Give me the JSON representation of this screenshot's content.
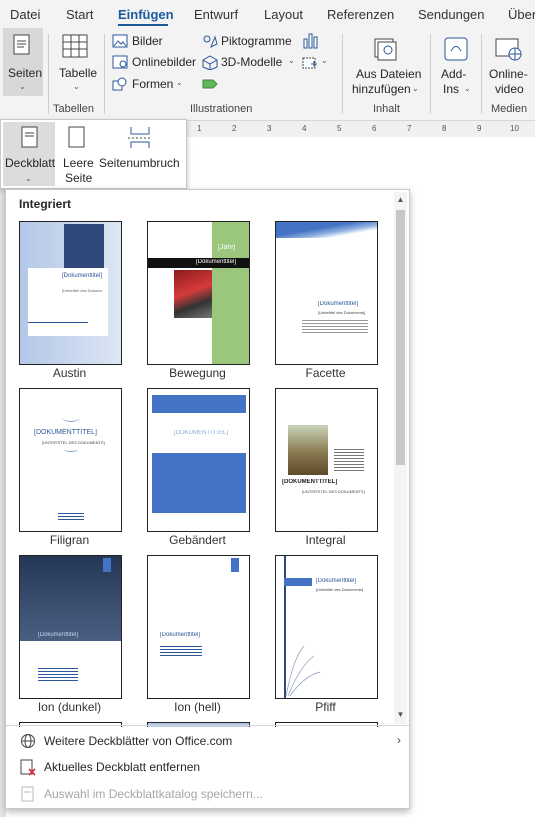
{
  "tabs": [
    "Datei",
    "Start",
    "Einfügen",
    "Entwurf",
    "Layout",
    "Referenzen",
    "Sendungen",
    "Über"
  ],
  "active_tab": "Einfügen",
  "ribbon": {
    "pages": "Seiten",
    "table": "Tabelle",
    "tables_group": "Tabellen",
    "pictures": "Bilder",
    "online_pictures": "Onlinebilder",
    "shapes": "Formen",
    "pictograms": "Piktogramme",
    "models_3d": "3D-Modelle",
    "illustrations_group": "Illustrationen",
    "from_files_line1": "Aus Dateien",
    "from_files_line2": "hinzufügen",
    "content_group": "Inhalt",
    "addins_line1": "Add-",
    "addins_line2": "Ins",
    "online_video_line1": "Online-",
    "online_video_line2": "video",
    "media_group": "Medien"
  },
  "ruler_ticks": [
    "1",
    "2",
    "3",
    "4",
    "5",
    "6",
    "7",
    "8",
    "9",
    "10"
  ],
  "pages_menu": {
    "cover": "Deckblatt",
    "blank_line1": "Leere",
    "blank_line2": "Seite",
    "page_break": "Seitenumbruch"
  },
  "gallery": {
    "header": "Integriert",
    "templates": [
      {
        "name": "Austin",
        "title": "[Dokumenttitel]",
        "subtitle": "[Untertitel des Dokuments]"
      },
      {
        "name": "Bewegung",
        "title": "[Dokumenttitel]",
        "year": "[Jahr]"
      },
      {
        "name": "Facette",
        "title": "[Dokumenttitel]",
        "subtitle": "[Untertitel des Dokuments]"
      },
      {
        "name": "Filigran",
        "title": "[DOKUMENTTITEL]",
        "subtitle": "[UNTERTITEL DES DOKUMENTS]"
      },
      {
        "name": "Gebändert",
        "title": "[DOKUMENTTITEL]"
      },
      {
        "name": "Integral",
        "title": "[DOKUMENTTITEL]",
        "subtitle": "[UNTERTITEL DES DOKUMENTS]"
      },
      {
        "name": "Ion (dunkel)",
        "title": "[Dokumenttitel]"
      },
      {
        "name": "Ion (hell)",
        "title": "[Dokumenttitel]"
      },
      {
        "name": "Pfiff",
        "title": "[Dokumenttitel]",
        "subtitle": "[Untertitel des Dokuments]"
      }
    ],
    "menu": {
      "more_office": "Weitere Deckblätter von Office.com",
      "remove": "Aktuelles Deckblatt entfernen",
      "save_selection": "Auswahl im Deckblattkatalog speichern..."
    }
  },
  "colors": {
    "accent": "#1c5a9e",
    "ribbon_bg": "#f3f3f3",
    "cover_blue": "#4472c4",
    "bewegung_green": "#9bc77c"
  }
}
